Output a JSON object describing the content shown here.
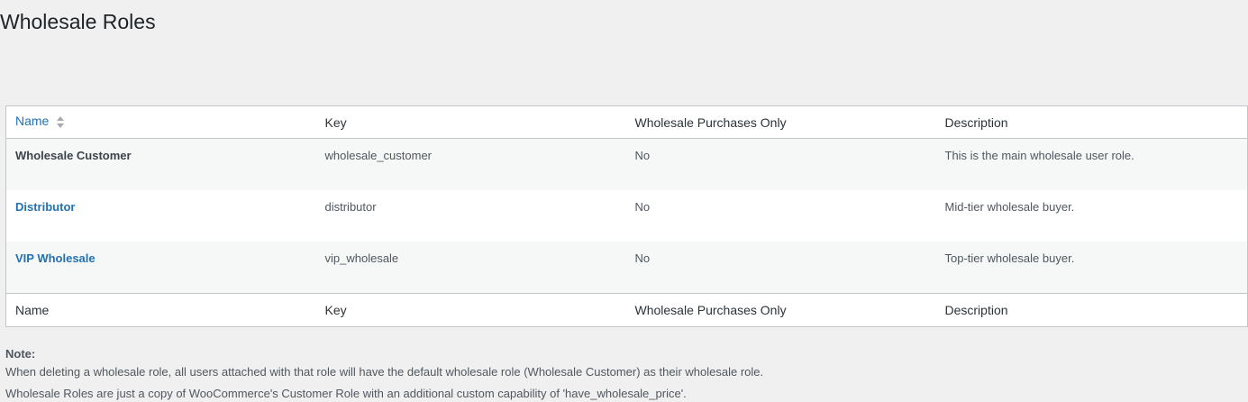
{
  "page": {
    "title": "Wholesale Roles"
  },
  "table": {
    "columns": {
      "name": "Name",
      "key": "Key",
      "purchases_only": "Wholesale Purchases Only",
      "description": "Description"
    },
    "sortable_column": "name",
    "rows": [
      {
        "name": "Wholesale Customer",
        "key": "wholesale_customer",
        "purchases_only": "No",
        "description": "This is the main wholesale user role.",
        "linked": false
      },
      {
        "name": "Distributor",
        "key": "distributor",
        "purchases_only": "No",
        "description": "Mid-tier wholesale buyer.",
        "linked": true
      },
      {
        "name": "VIP Wholesale",
        "key": "vip_wholesale",
        "purchases_only": "No",
        "description": "Top-tier wholesale buyer.",
        "linked": true
      }
    ]
  },
  "notes": {
    "label": "Note:",
    "line1": "When deleting a wholesale role, all users attached with that role will have the default wholesale role (Wholesale Customer) as their wholesale role.",
    "line2": "Wholesale Roles are just a copy of WooCommerce's Customer Role with an additional custom capability of 'have_wholesale_price'."
  },
  "colors": {
    "link": "#2271b1",
    "background": "#f0f0f1",
    "row_alt": "#f6f7f7",
    "border": "#c3c4c7"
  }
}
